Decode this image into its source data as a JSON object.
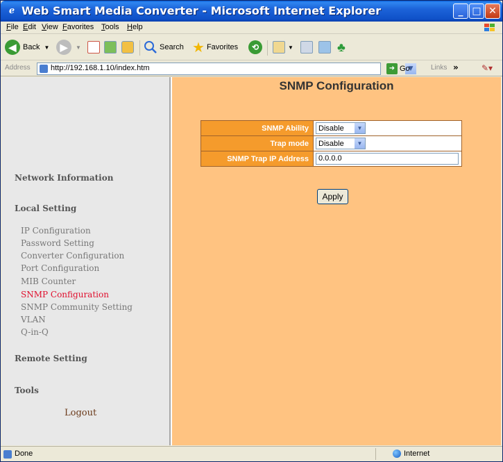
{
  "window": {
    "title": "Web Smart Media Converter - Microsoft Internet Explorer",
    "controls": {
      "minimize": "_",
      "maximize": "□",
      "close": "✕"
    }
  },
  "menu": [
    "File",
    "Edit",
    "View",
    "Favorites",
    "Tools",
    "Help"
  ],
  "toolbar": {
    "back": "Back",
    "search": "Search",
    "favorites": "Favorites"
  },
  "address": {
    "label": "Address",
    "url": "http://192.168.1.10/index.htm",
    "go": "Go",
    "links": "Links"
  },
  "sidebar": {
    "network_information": "Network Information",
    "local_setting": "Local Setting",
    "items": [
      {
        "label": "IP Configuration",
        "active": false
      },
      {
        "label": "Password Setting",
        "active": false
      },
      {
        "label": "Converter Configuration",
        "active": false
      },
      {
        "label": "Port Configuration",
        "active": false
      },
      {
        "label": "MIB Counter",
        "active": false
      },
      {
        "label": "SNMP Configuration",
        "active": true
      },
      {
        "label": "SNMP Community Setting",
        "active": false
      },
      {
        "label": "VLAN",
        "active": false
      },
      {
        "label": "Q-in-Q",
        "active": false
      }
    ],
    "remote_setting": "Remote Setting",
    "tools": "Tools",
    "logout": "Logout"
  },
  "main": {
    "title": "SNMP Configuration",
    "fields": [
      {
        "label": "SNMP Ability",
        "type": "select",
        "value": "Disable"
      },
      {
        "label": "Trap mode",
        "type": "select",
        "value": "Disable"
      },
      {
        "label": "SNMP Trap IP Address",
        "type": "text",
        "value": "0.0.0.0"
      }
    ],
    "apply": "Apply"
  },
  "status": {
    "text": "Done",
    "zone": "Internet"
  },
  "colors": {
    "main_bg": "#ffc381",
    "label_bg": "#f59b2c",
    "active_link": "#e0102e",
    "sidebar_bg": "#e8e8e8"
  }
}
